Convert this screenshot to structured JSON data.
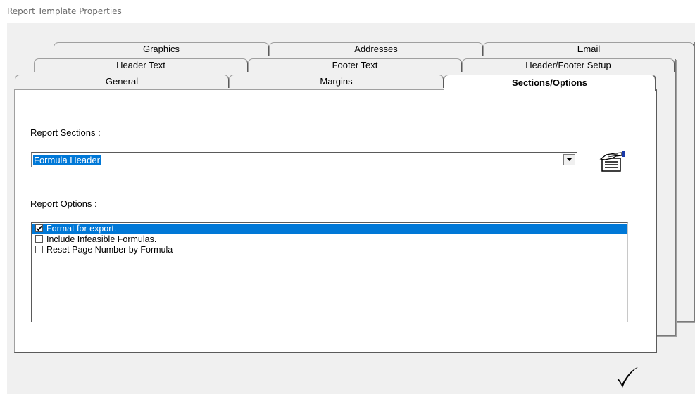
{
  "window": {
    "title": "Report Template Properties"
  },
  "tabs": {
    "row1": [
      {
        "label": "Graphics"
      },
      {
        "label": "Addresses"
      },
      {
        "label": "Email"
      }
    ],
    "row2": [
      {
        "label": "Header Text"
      },
      {
        "label": "Footer Text"
      },
      {
        "label": "Header/Footer Setup"
      }
    ],
    "row3": [
      {
        "label": "General"
      },
      {
        "label": "Margins"
      },
      {
        "label": "Sections/Options",
        "active": true
      }
    ]
  },
  "sections": {
    "label": "Report Sections :",
    "selected_value": "Formula Header",
    "icon": "report-section-icon"
  },
  "options": {
    "label": "Report Options :",
    "items": [
      {
        "label": "Format for export.",
        "checked": true,
        "selected": true
      },
      {
        "label": "Include Infeasible Formulas.",
        "checked": false,
        "selected": false
      },
      {
        "label": "Reset Page Number by Formula",
        "checked": false,
        "selected": false
      }
    ]
  },
  "actions": {
    "ok_icon": "checkmark-icon"
  },
  "colors": {
    "selection": "#0078d7",
    "dialog_bg": "#f0f0f0"
  }
}
